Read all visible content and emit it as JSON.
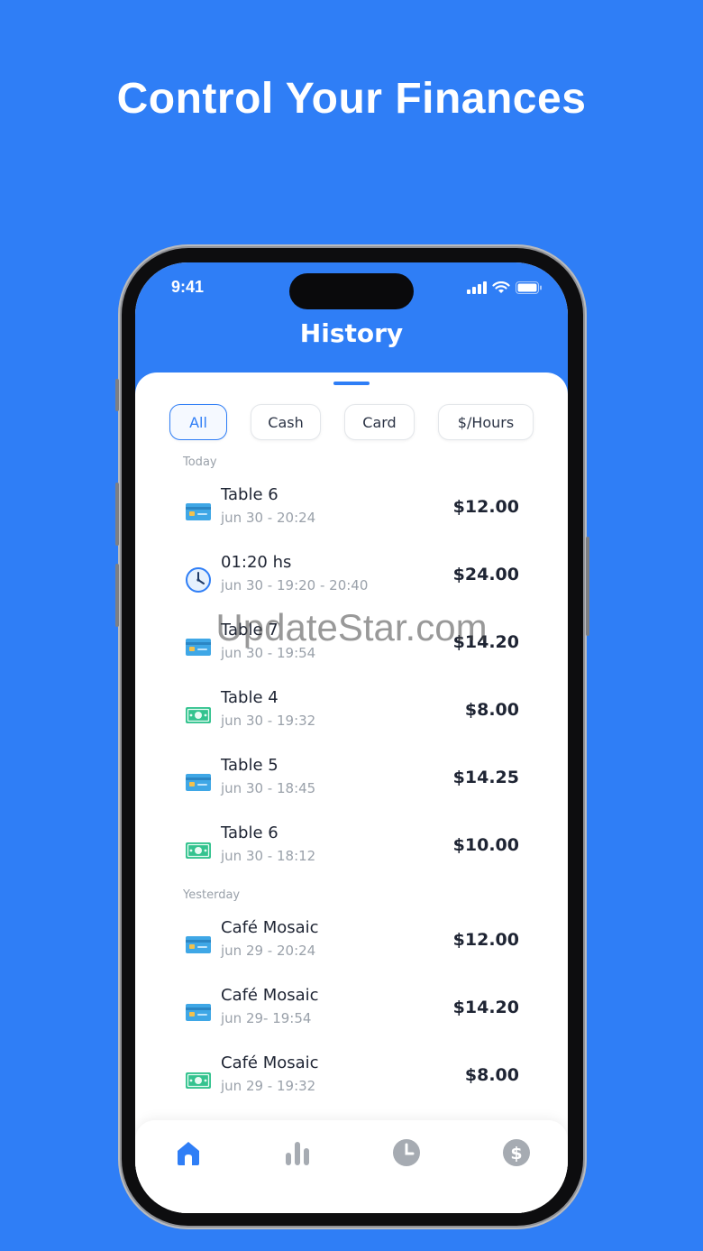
{
  "headline": "Control Your Finances",
  "status_bar": {
    "time": "9:41"
  },
  "screen": {
    "title": "History"
  },
  "filters": [
    {
      "label": "All",
      "active": true
    },
    {
      "label": "Cash",
      "active": false
    },
    {
      "label": "Card",
      "active": false
    },
    {
      "label": "$/Hours",
      "active": false
    }
  ],
  "sections": {
    "today": "Today",
    "yesterday": "Yesterday"
  },
  "transactions": [
    {
      "name": "Table 6",
      "date": "jun 30 - 20:24",
      "amount": "$12.00",
      "icon": "credit-card-icon"
    },
    {
      "name": "01:20 hs",
      "date": "jun 30 - 19:20 - 20:40",
      "amount": "$24.00",
      "icon": "clock-icon"
    },
    {
      "name": "Table 7",
      "date": "jun 30 - 19:54",
      "amount": "$14.20",
      "icon": "credit-card-icon"
    },
    {
      "name": "Table 4",
      "date": "jun 30 - 19:32",
      "amount": "$8.00",
      "icon": "cash-icon"
    },
    {
      "name": "Table 5",
      "date": "jun 30 - 18:45",
      "amount": "$14.25",
      "icon": "credit-card-icon"
    },
    {
      "name": "Table 6",
      "date": "jun 30 - 18:12",
      "amount": "$10.00",
      "icon": "cash-icon"
    },
    {
      "name": "Café Mosaic",
      "date": "jun 29 - 20:24",
      "amount": "$12.00",
      "icon": "credit-card-icon"
    },
    {
      "name": "Café Mosaic",
      "date": "jun 29- 19:54",
      "amount": "$14.20",
      "icon": "credit-card-icon"
    },
    {
      "name": "Café Mosaic",
      "date": "jun 29 - 19:32",
      "amount": "$8.00",
      "icon": "cash-icon"
    }
  ],
  "tabbar": [
    {
      "icon": "home-icon",
      "active": true
    },
    {
      "icon": "bar-chart-icon",
      "active": false
    },
    {
      "icon": "clock-icon",
      "active": false
    },
    {
      "icon": "dollar-icon",
      "active": false
    }
  ],
  "watermark": "UpdateStar.com",
  "colors": {
    "brand": "#2f7ef6",
    "inactive_icon": "#a6abb2",
    "text": "#1e2433",
    "muted": "#9aa1aa"
  }
}
